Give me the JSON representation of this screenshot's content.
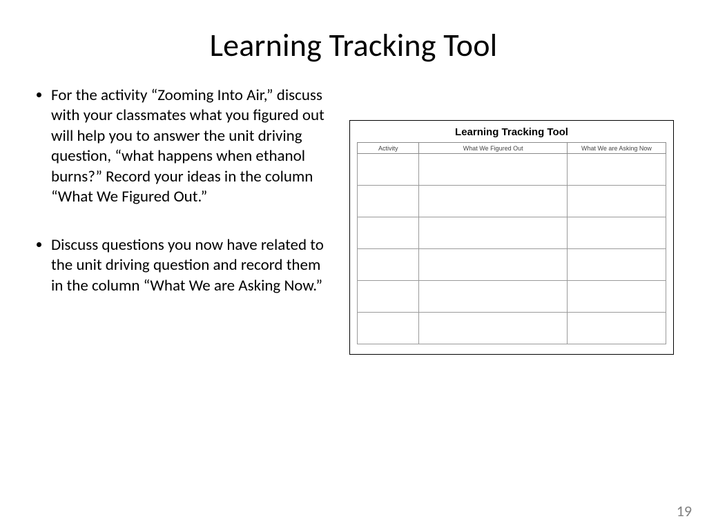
{
  "title": "Learning Tracking Tool",
  "bullets": [
    "For the activity “Zooming Into Air,” discuss with your classmates what you figured out will help you to answer the unit driving question, “what happens when ethanol burns?” Record your ideas in the column “What We Figured Out.”",
    "Discuss questions you now have related to the unit driving question and record them in the column “What We are Asking Now.”"
  ],
  "worksheet": {
    "heading": "Learning Tracking Tool",
    "columns": [
      "Activity",
      "What We Figured Out",
      "What We are Asking Now"
    ],
    "empty_rows": 6
  },
  "page_number": "19"
}
